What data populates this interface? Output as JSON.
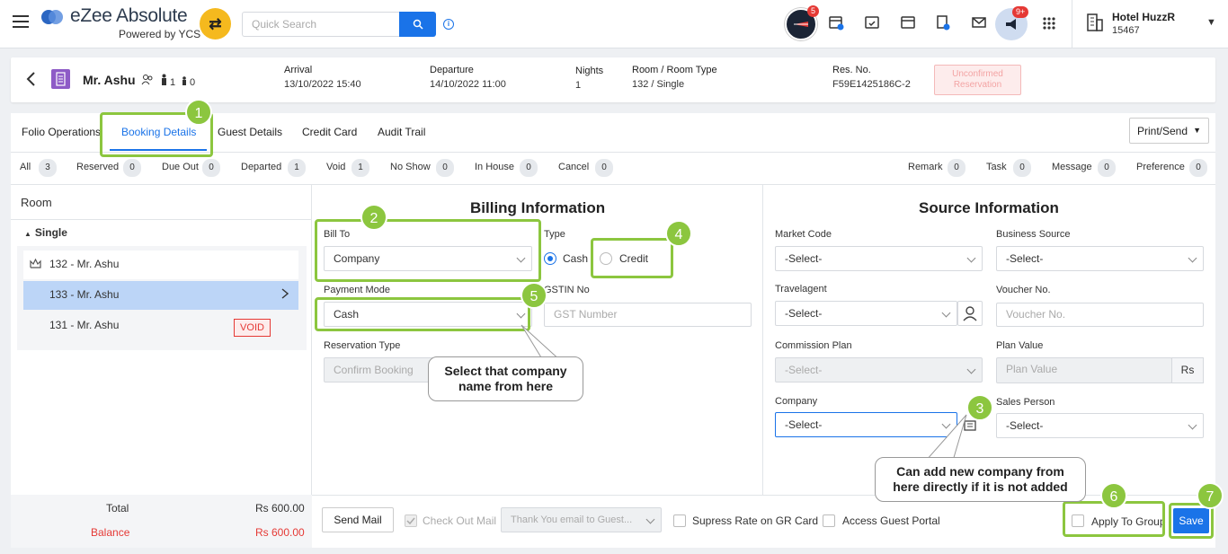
{
  "app": {
    "logo_title": "eZee Absolute",
    "logo_sub": "Powered by YCS",
    "search_placeholder": "Quick Search",
    "badges": {
      "compass": "5",
      "megaphone": "9+"
    },
    "hotel_name": "Hotel HuzzR",
    "hotel_id": "15467",
    "icons": [
      "menu-icon",
      "shuffle-icon",
      "search-icon",
      "info-icon",
      "compass-icon",
      "calendar-add-icon",
      "calendar-check-icon",
      "calendar-icon",
      "billing-icon",
      "mail-icon",
      "megaphone-icon",
      "apps-grid-icon",
      "hotel-building-icon"
    ]
  },
  "guest": {
    "name": "Mr. Ashu",
    "adults": "1",
    "children": "0",
    "arrival_label": "Arrival",
    "arrival_value": "13/10/2022 15:40",
    "departure_label": "Departure",
    "departure_value": "14/10/2022 11:00",
    "nights_label": "Nights",
    "nights_value": "1",
    "room_label": "Room / Room Type",
    "room_value": "132 / Single",
    "resno_label": "Res. No.",
    "resno_value": "F59E1425186C-2",
    "status_line1": "Unconfirmed",
    "status_line2": "Reservation"
  },
  "tabs": {
    "folio": "Folio Operations",
    "booking": "Booking Details",
    "guest": "Guest Details",
    "credit": "Credit Card",
    "audit": "Audit Trail",
    "print": "Print/Send"
  },
  "filters": [
    {
      "label": "All",
      "count": "3"
    },
    {
      "label": "Reserved",
      "count": "0"
    },
    {
      "label": "Due Out",
      "count": "0"
    },
    {
      "label": "Departed",
      "count": "1"
    },
    {
      "label": "Void",
      "count": "1"
    },
    {
      "label": "No Show",
      "count": "0"
    },
    {
      "label": "In House",
      "count": "0"
    },
    {
      "label": "Cancel",
      "count": "0"
    },
    {
      "label": "Remark",
      "count": "0"
    },
    {
      "label": "Task",
      "count": "0"
    },
    {
      "label": "Message",
      "count": "0"
    },
    {
      "label": "Preference",
      "count": "0"
    }
  ],
  "rooms": {
    "header": "Room",
    "group": "Single",
    "items": [
      "132 - Mr. Ashu",
      "133 - Mr. Ashu",
      "131 - Mr. Ashu"
    ],
    "void_tag": "VOID",
    "total_label": "Total",
    "total_value": "Rs 600.00",
    "balance_label": "Balance",
    "balance_value": "Rs 600.00"
  },
  "billing": {
    "title": "Billing Information",
    "bill_to_label": "Bill To",
    "bill_to_value": "Company",
    "type_label": "Type",
    "cash_label": "Cash",
    "credit_label": "Credit",
    "payment_mode_label": "Payment Mode",
    "payment_mode_value": "Cash",
    "gstin_label": "GSTIN No",
    "gstin_placeholder": "GST Number",
    "reservation_type_label": "Reservation Type",
    "reservation_type_value": "Confirm Booking"
  },
  "source": {
    "title": "Source Information",
    "market_code_label": "Market Code",
    "market_code_value": "-Select-",
    "business_source_label": "Business Source",
    "business_source_value": "-Select-",
    "travelagent_label": "Travelagent",
    "travelagent_value": "-Select-",
    "voucher_label": "Voucher No.",
    "voucher_placeholder": "Voucher No.",
    "commission_label": "Commission Plan",
    "commission_value": "-Select-",
    "plan_value_label": "Plan Value",
    "plan_value_placeholder": "Plan Value",
    "currency": "Rs",
    "company_label": "Company",
    "company_value": "-Select-",
    "sales_person_label": "Sales Person",
    "sales_person_value": "-Select-"
  },
  "footer": {
    "send_mail": "Send Mail",
    "checkout_mail": "Check Out Mail",
    "email_template": "Thank You email to Guest...",
    "suppress_rate": "Supress Rate on GR Card",
    "guest_portal": "Access Guest Portal",
    "apply_group": "Apply To Group",
    "save": "Save"
  },
  "annotations": {
    "n1": "1",
    "n2": "2",
    "n3": "3",
    "n4": "4",
    "n5": "5",
    "n6": "6",
    "n7": "7",
    "callout_company_line1": "Select that company",
    "callout_company_line2": "name from here",
    "callout_add_line1": "Can add new company from",
    "callout_add_line2": "here directly if it is not added",
    "highlight_color": "#8cc63f"
  }
}
